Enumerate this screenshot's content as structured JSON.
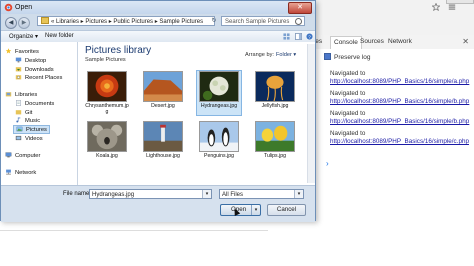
{
  "dialog": {
    "title": "Open",
    "close_label": "✕",
    "address": {
      "back": "◀",
      "forward": "▶",
      "path": "« Libraries ▸ Pictures ▸ Public Pictures ▸ Sample Pictures",
      "refresh": "↻",
      "search_placeholder": "Search Sample Pictures"
    },
    "toolbar": {
      "organize": "Organize ▾",
      "new_folder": "New folder"
    },
    "nav": {
      "favorites": "Favorites",
      "desktop": "Desktop",
      "downloads": "Downloads",
      "recent": "Recent Places",
      "libraries": "Libraries",
      "documents": "Documents",
      "git": "Git",
      "music": "Music",
      "pictures": "Pictures",
      "videos": "Videos",
      "computer": "Computer",
      "network": "Network"
    },
    "library": {
      "title": "Pictures library",
      "subtitle": "Sample Pictures",
      "arrange_label": "Arrange by:",
      "arrange_value": "Folder ▾"
    },
    "files": [
      {
        "name": "Chrysanthemum.jpg"
      },
      {
        "name": "Desert.jpg"
      },
      {
        "name": "Hydrangeas.jpg"
      },
      {
        "name": "Jellyfish.jpg"
      },
      {
        "name": "Koala.jpg"
      },
      {
        "name": "Lighthouse.jpg"
      },
      {
        "name": "Penguins.jpg"
      },
      {
        "name": "Tulips.jpg"
      }
    ],
    "bottom": {
      "filename_label": "File name:",
      "filename_value": "Hydrangeas.jpg",
      "filetype_value": "All Files",
      "open_label": "Open",
      "cancel_label": "Cancel",
      "dropdown_glyph": "▾"
    }
  },
  "devtools": {
    "tabs": [
      "ces",
      "Console",
      "Sources",
      "Network"
    ],
    "close": "✕",
    "preserve_log": "Preserve log",
    "logs": [
      {
        "prefix": "Navigated to",
        "url": "http://localhost:8089/PHP_Basics/16/simple/a.php"
      },
      {
        "prefix": "Navigated to",
        "url": "http://localhost:8089/PHP_Basics/16/simple/b.php"
      },
      {
        "prefix": "Navigated to",
        "url": "http://localhost:8089/PHP_Basics/16/simple/b.php"
      },
      {
        "prefix": "Navigated to",
        "url": "http://localhost:8089/PHP_Basics/16/simple/c.php"
      }
    ],
    "prompt": "›"
  }
}
